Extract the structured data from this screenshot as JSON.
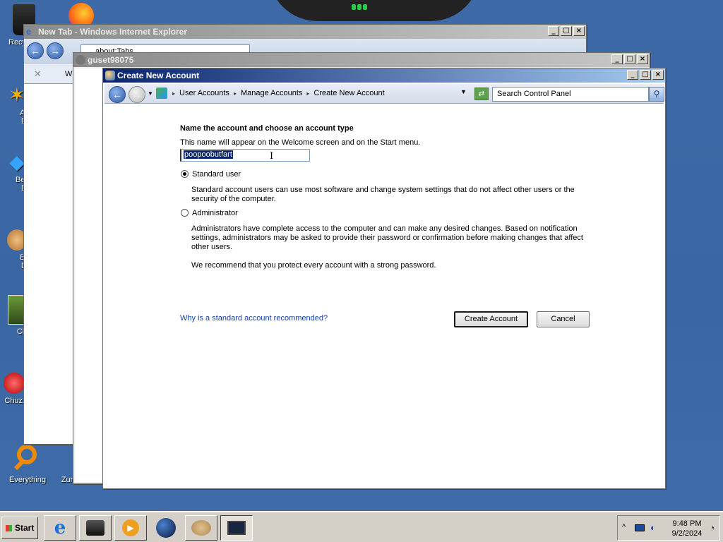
{
  "desktop": {
    "icons": [
      {
        "label": "Recy"
      },
      {
        "label": "Ast\nDe"
      },
      {
        "label": "Beje\nDe"
      },
      {
        "label": "Big\nDe"
      },
      {
        "label": "Cho"
      },
      {
        "label": "Chuzzl"
      },
      {
        "label": "Everything"
      },
      {
        "label": "Zur"
      }
    ]
  },
  "background_windows": {
    "ie": {
      "title": "New Tab - Windows Internet Explorer",
      "address": "about:Tabs",
      "tab_label": "W"
    },
    "guest": {
      "title": "guset98075"
    }
  },
  "main_window": {
    "title": "Create New Account",
    "breadcrumbs": [
      "User Accounts",
      "Manage Accounts",
      "Create New Account"
    ],
    "search_placeholder": "Search Control Panel",
    "heading": "Name the account and choose an account type",
    "subtext": "This name will appear on the Welcome screen and on the Start menu.",
    "name_value": "poopoobutfart",
    "options": [
      {
        "label": "Standard user",
        "selected": true,
        "description": "Standard account users can use most software and change system settings that do not affect other users or the security of the computer."
      },
      {
        "label": "Administrator",
        "selected": false,
        "description": "Administrators have complete access to the computer and can make any desired changes. Based on notification settings, administrators may be asked to provide their password or confirmation before making changes that affect other users."
      }
    ],
    "recommendation": "We recommend that you protect every account with a strong password.",
    "help_link": "Why is a standard account recommended?",
    "create_button": "Create Account",
    "cancel_button": "Cancel"
  },
  "taskbar": {
    "start_label": "Start",
    "clock_time": "9:48 PM",
    "clock_date": "9/2/2024"
  },
  "colors": {
    "desktop": "#3a6ea5",
    "active_title": "#0a246a",
    "link": "#1a3ea0",
    "selection": "#0a246a"
  }
}
